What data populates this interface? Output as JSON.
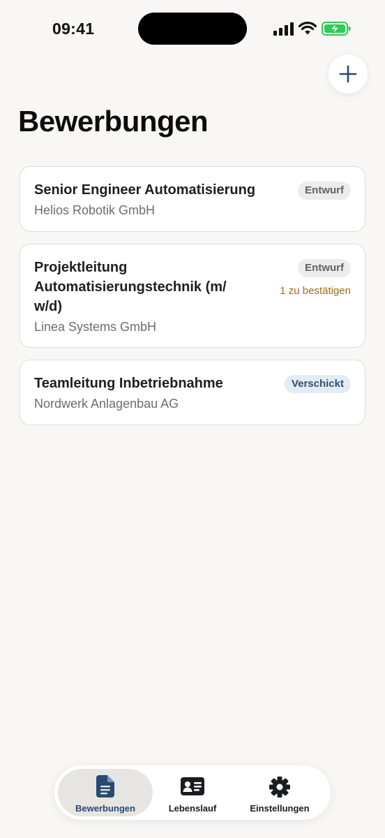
{
  "status_bar": {
    "time": "09:41"
  },
  "header": {
    "title": "Bewerbungen",
    "add_icon": "plus-icon"
  },
  "applications": [
    {
      "title": "Senior Engineer Automatisierung",
      "company": "Helios Robotik GmbH",
      "status": "Entwurf",
      "pending": ""
    },
    {
      "title_lines": [
        "Projektleitung",
        "Automatisierungstechnik (m/",
        "w/d)"
      ],
      "company": "Linea Systems GmbH",
      "status": "Entwurf",
      "pending": "1 zu bestätigen"
    },
    {
      "title": "Teamleitung Inbetriebnahme",
      "company": "Nordwerk Anlagenbau AG",
      "status": "Verschickt",
      "pending": ""
    }
  ],
  "tab_bar": {
    "tabs": [
      {
        "label": "Bewerbungen",
        "icon": "document-icon",
        "active": true
      },
      {
        "label": "Lebenslauf",
        "icon": "id-card-icon",
        "active": false
      },
      {
        "label": "Einstellungen",
        "icon": "gear-icon",
        "active": false
      }
    ]
  },
  "colors": {
    "background": "#f8f7f5",
    "accent": "#264a70",
    "pending": "#a46d12",
    "battery": "#34c759"
  }
}
